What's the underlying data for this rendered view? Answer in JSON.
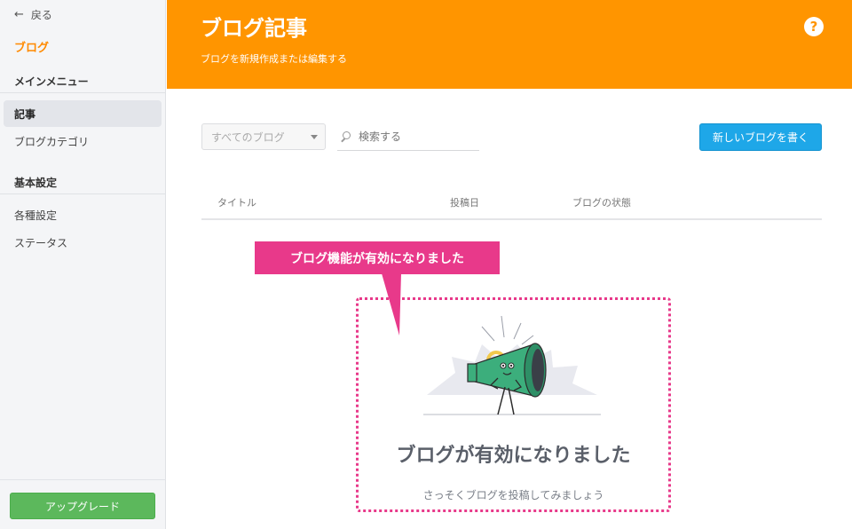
{
  "sidebar": {
    "back_label": "戻る",
    "title": "ブログ",
    "main_menu_heading": "メインメニュー",
    "items_main": [
      {
        "label": "記事",
        "active": true
      },
      {
        "label": "ブログカテゴリ",
        "active": false
      }
    ],
    "basic_settings_heading": "基本設定",
    "items_settings": [
      {
        "label": "各種設定"
      },
      {
        "label": "ステータス"
      }
    ],
    "upgrade_label": "アップグレード"
  },
  "header": {
    "title": "ブログ記事",
    "subtitle": "ブログを新規作成または編集する",
    "help_icon": "?"
  },
  "toolbar": {
    "filter_value": "すべてのブログ",
    "search_placeholder": "検索する",
    "new_button": "新しいブログを書く"
  },
  "table": {
    "columns": [
      "タイトル",
      "投稿日",
      "ブログの状態"
    ]
  },
  "callout": {
    "text": "ブログ機能が有効になりました"
  },
  "empty_state": {
    "title": "ブログが有効になりました",
    "subtitle": "さっそくブログを投稿してみましょう",
    "illustration": "megaphone-character-icon"
  },
  "colors": {
    "header_bg": "#ff9500",
    "accent_orange": "#ff8a00",
    "callout_pink": "#e8398a",
    "primary_button": "#1ea7e8",
    "upgrade_green": "#5cb85c"
  }
}
